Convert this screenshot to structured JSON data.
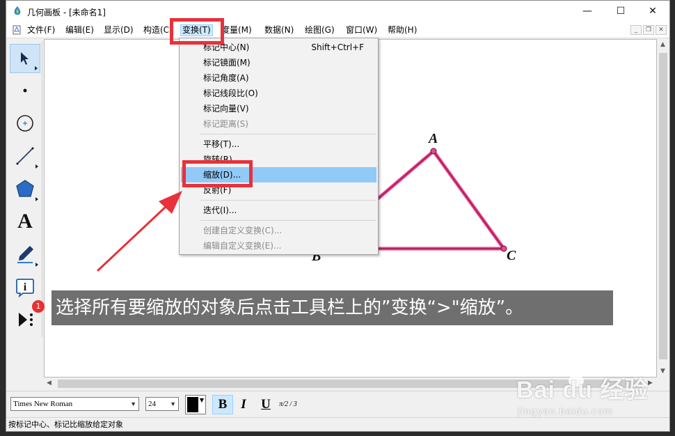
{
  "window": {
    "title": "几何画板 - [未命名1]",
    "controls": {
      "minimize": "—",
      "maximize": "☐",
      "close": "✕"
    }
  },
  "menubar": {
    "items": [
      "文件(F)",
      "编辑(E)",
      "显示(D)",
      "构造(C)",
      "变换(T)",
      "度量(M)",
      "数据(N)",
      "绘图(G)",
      "窗口(W)",
      "帮助(H)"
    ],
    "active_index": 4,
    "mdi": {
      "minimize": "_",
      "restore": "❐",
      "close": "✕"
    }
  },
  "transform_menu": {
    "items": [
      {
        "label": "标记中心(N)",
        "shortcut": "Shift+Ctrl+F",
        "enabled": true
      },
      {
        "label": "标记镜面(M)",
        "shortcut": "",
        "enabled": true
      },
      {
        "label": "标记角度(A)",
        "shortcut": "",
        "enabled": true
      },
      {
        "label": "标记线段比(O)",
        "shortcut": "",
        "enabled": true
      },
      {
        "label": "标记向量(V)",
        "shortcut": "",
        "enabled": true
      },
      {
        "label": "标记距离(S)",
        "shortcut": "",
        "enabled": false
      },
      {
        "label": "平移(T)...",
        "shortcut": "",
        "enabled": true
      },
      {
        "label": "旋转(R)...",
        "shortcut": "",
        "enabled": true
      },
      {
        "label": "缩放(D)...",
        "shortcut": "",
        "enabled": true,
        "highlighted": true
      },
      {
        "label": "反射(F)",
        "shortcut": "",
        "enabled": true
      },
      {
        "label": "迭代(I)...",
        "shortcut": "",
        "enabled": true
      },
      {
        "label": "创建自定义变换(C)...",
        "shortcut": "",
        "enabled": false
      },
      {
        "label": "编辑自定义变换(E)...",
        "shortcut": "",
        "enabled": false
      }
    ]
  },
  "toolbox": {
    "tools": [
      "arrow-select",
      "point",
      "compass",
      "straightedge",
      "polygon",
      "text",
      "marker",
      "information",
      "custom-tools"
    ],
    "text_tool_glyph": "A",
    "info_tool_glyph": "i"
  },
  "canvas": {
    "points": {
      "A": "A",
      "B": "B",
      "C": "C"
    },
    "triangle_color": "#d81b60"
  },
  "formatbar": {
    "font_name": "Times New Roman",
    "font_size": "24",
    "bold": "B",
    "italic": "I",
    "underline": "U",
    "math": "π/2 / 3"
  },
  "status": {
    "text": "按标记中心、标记比缩放给定对象"
  },
  "overlay": {
    "step_badge": "1",
    "banner_text": "选择所有要缩放的对象后点击工具栏上的”变换“>\"缩放”。",
    "accent_color": "#e8313a"
  },
  "watermark": {
    "brand": "Bai du 经验",
    "url": "jingyan.baidu.com"
  }
}
